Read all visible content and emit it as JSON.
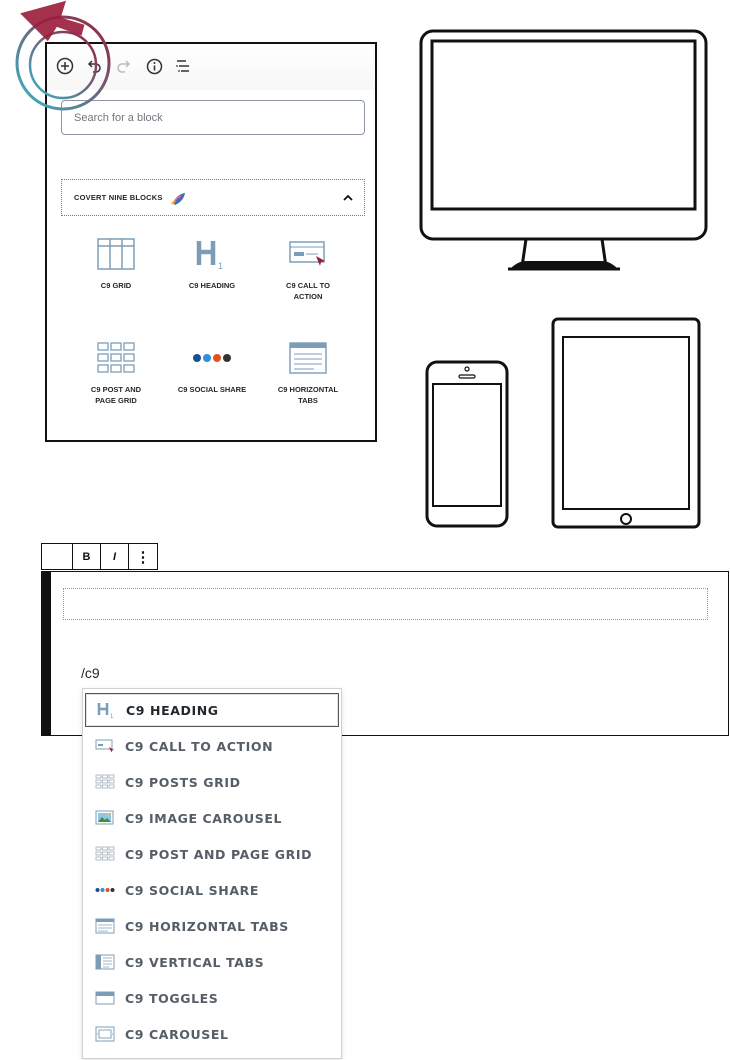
{
  "toolbar": {
    "icons": [
      "add-block-icon",
      "undo-icon",
      "redo-icon",
      "info-icon",
      "block-navigation-icon"
    ]
  },
  "search": {
    "placeholder": "Search for a block"
  },
  "category": {
    "title": "COVERT NINE BLOCKS",
    "icon": "rocket-icon",
    "expanded": true
  },
  "blocks": [
    {
      "label": "C9 GRID",
      "icon": "grid-icon"
    },
    {
      "label": "C9 HEADING",
      "icon": "heading-icon"
    },
    {
      "label": "C9 CALL TO\nACTION",
      "icon": "call-to-action-icon"
    },
    {
      "label": "C9 POST AND\nPAGE GRID",
      "icon": "post-grid-icon"
    },
    {
      "label": "C9 SOCIAL SHARE",
      "icon": "social-share-icon"
    },
    {
      "label": "C9 HORIZONTAL\nTABS",
      "icon": "horizontal-tabs-icon"
    }
  ],
  "format_toolbar": {
    "bold": "B",
    "italic": "I",
    "more": "⋮"
  },
  "editor": {
    "typed_text": "/c9"
  },
  "autocomplete": {
    "items": [
      {
        "label": "C9 HEADING",
        "icon": "heading-icon",
        "selected": true
      },
      {
        "label": "C9 CALL TO ACTION",
        "icon": "call-to-action-icon"
      },
      {
        "label": "C9 POSTS GRID",
        "icon": "posts-grid-icon"
      },
      {
        "label": "C9 IMAGE CAROUSEL",
        "icon": "image-carousel-icon"
      },
      {
        "label": "C9 POST AND PAGE GRID",
        "icon": "post-grid-icon"
      },
      {
        "label": "C9 SOCIAL SHARE",
        "icon": "social-share-icon"
      },
      {
        "label": "C9 HORIZONTAL TABS",
        "icon": "horizontal-tabs-icon"
      },
      {
        "label": "C9 VERTICAL TABS",
        "icon": "vertical-tabs-icon"
      },
      {
        "label": "C9 TOGGLES",
        "icon": "toggles-icon"
      },
      {
        "label": "C9 CAROUSEL",
        "icon": "carousel-icon"
      }
    ]
  },
  "colors": {
    "accent_blue": "#7c9db8",
    "highlight_red": "#9b1c3a",
    "highlight_cyan": "#3ab7c9",
    "border": "#111111"
  }
}
